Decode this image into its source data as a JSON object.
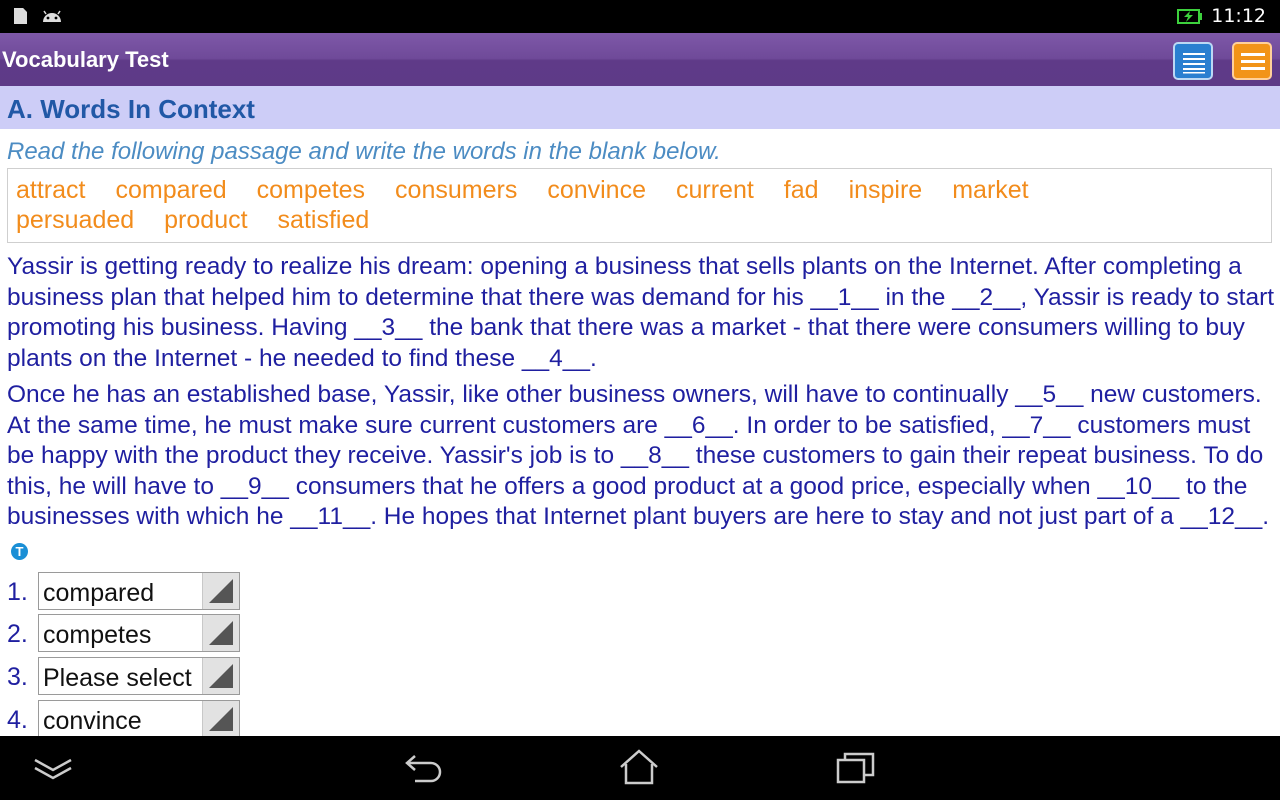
{
  "status_bar": {
    "time": "11:12",
    "icons": [
      "sd-card-icon",
      "android-icon",
      "battery-charging-icon"
    ]
  },
  "app_bar": {
    "title": "Vocabulary Test",
    "buttons": [
      "list-view-icon",
      "menu-icon"
    ],
    "colors": {
      "bar": "#6f4a99",
      "list_button": "#2a7fd0",
      "menu_button": "#f29418"
    }
  },
  "section": {
    "title": "A. Words In Context",
    "instructions": "Read the following passage and write the words in the blank below."
  },
  "word_bank": [
    "attract",
    "compared",
    "competes",
    "consumers",
    "convince",
    "current",
    "fad",
    "inspire",
    "market",
    "persuaded",
    "product",
    "satisfied"
  ],
  "passage": {
    "paragraph1": "Yassir is getting ready to realize his dream: opening a business that sells plants on the Internet. After completing a business plan that helped him to determine that there was demand for his __1__ in the __2__, Yassir is ready to start promoting his business. Having __3__ the bank that there was a market - that there were consumers willing to buy plants on the Internet - he needed to find these __4__.",
    "paragraph2": "Once he has an established base, Yassir, like other business owners, will have to continually __5__ new customers. At the same time, he must make sure current customers are __6__. In order to be satisfied, __7__ customers must be happy with the product they receive. Yassir's job is to __8__ these customers to gain their repeat business. To do this, he will have to __9__ consumers that he offers a good product at a good price, especially when __10__ to the businesses with which he __11__. He hopes that Internet plant buyers are here to stay and not just part of a __12__.",
    "info_icon_label": "T"
  },
  "answers": [
    {
      "number": "1.",
      "value": "compared"
    },
    {
      "number": "2.",
      "value": "competes"
    },
    {
      "number": "3.",
      "value": "Please select"
    },
    {
      "number": "4.",
      "value": "convince"
    }
  ],
  "nav_bar": {
    "buttons": [
      "hide-keyboard-icon",
      "back-icon",
      "home-icon",
      "recent-apps-icon"
    ]
  }
}
